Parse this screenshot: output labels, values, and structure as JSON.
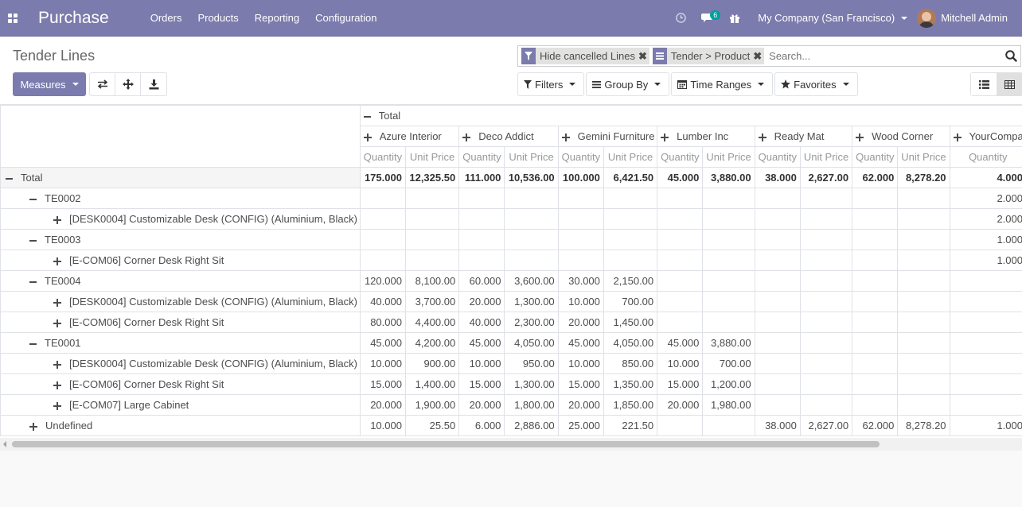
{
  "navbar": {
    "brand": "Purchase",
    "menu": [
      "Orders",
      "Products",
      "Reporting",
      "Configuration"
    ],
    "messages_count": "6",
    "company": "My Company (San Francisco)",
    "user": "Mitchell Admin"
  },
  "control_panel": {
    "breadcrumb": "Tender Lines",
    "facets": [
      "Hide cancelled Lines",
      "Tender > Product"
    ],
    "search_placeholder": "Search...",
    "measures_label": "Measures",
    "filters_label": "Filters",
    "groupby_label": "Group By",
    "timeranges_label": "Time Ranges",
    "favorites_label": "Favorites"
  },
  "colors": {
    "navbar": "#7c7bad",
    "accent": "#7c7bad"
  },
  "pivot": {
    "col_total_label": "Total",
    "columns": [
      "Azure Interior",
      "Deco Addict",
      "Gemini Furniture",
      "Lumber Inc",
      "Ready Mat",
      "Wood Corner",
      "YourCompany"
    ],
    "measures": [
      "Quantity",
      "Unit Price"
    ],
    "rows": [
      {
        "label": "Total",
        "level": 0,
        "toggle": "minus",
        "bold": true,
        "values": [
          "175.000",
          "12,325.50",
          "111.000",
          "10,536.00",
          "100.000",
          "6,421.50",
          "45.000",
          "3,880.00",
          "38.000",
          "2,627.00",
          "62.000",
          "8,278.20",
          "4.000"
        ]
      },
      {
        "label": "TE0002",
        "level": 1,
        "toggle": "minus",
        "values": [
          "",
          "",
          "",
          "",
          "",
          "",
          "",
          "",
          "",
          "",
          "",
          "",
          "2.000"
        ]
      },
      {
        "label": "[DESK0004] Customizable Desk (CONFIG) (Aluminium, Black)",
        "level": 2,
        "toggle": "plus",
        "values": [
          "",
          "",
          "",
          "",
          "",
          "",
          "",
          "",
          "",
          "",
          "",
          "",
          "2.000"
        ]
      },
      {
        "label": "TE0003",
        "level": 1,
        "toggle": "minus",
        "values": [
          "",
          "",
          "",
          "",
          "",
          "",
          "",
          "",
          "",
          "",
          "",
          "",
          "1.000"
        ]
      },
      {
        "label": "[E-COM06] Corner Desk Right Sit",
        "level": 2,
        "toggle": "plus",
        "values": [
          "",
          "",
          "",
          "",
          "",
          "",
          "",
          "",
          "",
          "",
          "",
          "",
          "1.000"
        ]
      },
      {
        "label": "TE0004",
        "level": 1,
        "toggle": "minus",
        "values": [
          "120.000",
          "8,100.00",
          "60.000",
          "3,600.00",
          "30.000",
          "2,150.00",
          "",
          "",
          "",
          "",
          "",
          "",
          ""
        ]
      },
      {
        "label": "[DESK0004] Customizable Desk (CONFIG) (Aluminium, Black)",
        "level": 2,
        "toggle": "plus",
        "values": [
          "40.000",
          "3,700.00",
          "20.000",
          "1,300.00",
          "10.000",
          "700.00",
          "",
          "",
          "",
          "",
          "",
          "",
          ""
        ]
      },
      {
        "label": "[E-COM06] Corner Desk Right Sit",
        "level": 2,
        "toggle": "plus",
        "values": [
          "80.000",
          "4,400.00",
          "40.000",
          "2,300.00",
          "20.000",
          "1,450.00",
          "",
          "",
          "",
          "",
          "",
          "",
          ""
        ]
      },
      {
        "label": "TE0001",
        "level": 1,
        "toggle": "minus",
        "values": [
          "45.000",
          "4,200.00",
          "45.000",
          "4,050.00",
          "45.000",
          "4,050.00",
          "45.000",
          "3,880.00",
          "",
          "",
          "",
          "",
          ""
        ]
      },
      {
        "label": "[DESK0004] Customizable Desk (CONFIG) (Aluminium, Black)",
        "level": 2,
        "toggle": "plus",
        "values": [
          "10.000",
          "900.00",
          "10.000",
          "950.00",
          "10.000",
          "850.00",
          "10.000",
          "700.00",
          "",
          "",
          "",
          "",
          ""
        ]
      },
      {
        "label": "[E-COM06] Corner Desk Right Sit",
        "level": 2,
        "toggle": "plus",
        "values": [
          "15.000",
          "1,400.00",
          "15.000",
          "1,300.00",
          "15.000",
          "1,350.00",
          "15.000",
          "1,200.00",
          "",
          "",
          "",
          "",
          ""
        ]
      },
      {
        "label": "[E-COM07] Large Cabinet",
        "level": 2,
        "toggle": "plus",
        "values": [
          "20.000",
          "1,900.00",
          "20.000",
          "1,800.00",
          "20.000",
          "1,850.00",
          "20.000",
          "1,980.00",
          "",
          "",
          "",
          "",
          ""
        ]
      },
      {
        "label": "Undefined",
        "level": 1,
        "toggle": "plus",
        "values": [
          "10.000",
          "25.50",
          "6.000",
          "2,886.00",
          "25.000",
          "221.50",
          "",
          "",
          "38.000",
          "2,627.00",
          "62.000",
          "8,278.20",
          "1.000"
        ]
      }
    ]
  }
}
